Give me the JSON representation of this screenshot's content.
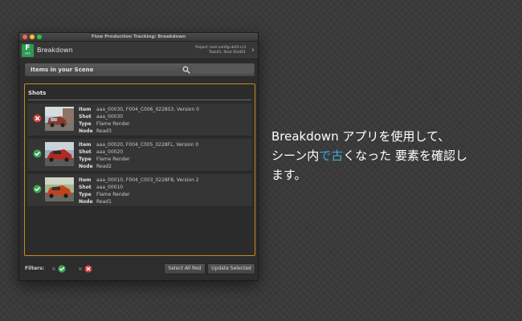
{
  "window": {
    "title": "Flow Production Tracking: Breakdown",
    "app_name": "Breakdown",
    "logo_letter": "F",
    "logo_sub": "FPT",
    "context_line1": "Project: test-config-def3-rc3",
    "context_line2": "Task01, Shot Shot01"
  },
  "items_bar": {
    "label": "Items in your Scene",
    "search_placeholder": ""
  },
  "shots_section": {
    "header": "Shots",
    "field_labels": {
      "item": "Item",
      "shot": "Shot",
      "type": "Type",
      "node": "Node"
    },
    "rows": [
      {
        "status": "out-of-date",
        "item": "aaa_00030, F004_C006_0228S3, Version 0",
        "shot": "aaa_00030",
        "type": "Flame Render",
        "node": "Read3"
      },
      {
        "status": "up-to-date",
        "item": "aaa_00020, F004_C005_0228FL, Version 0",
        "shot": "aaa_00020",
        "type": "Flame Render",
        "node": "Read2"
      },
      {
        "status": "up-to-date",
        "item": "aaa_00010, F004_C003_0228F8, Version 2",
        "shot": "aaa_00010",
        "type": "Flame Render",
        "node": "Read1"
      }
    ]
  },
  "footer": {
    "filters_label": "Filters:",
    "select_all_red": "Select All Red",
    "update_selected": "Update Selected"
  },
  "caption": {
    "line1": "Breakdown アプリを使用して、",
    "line2_a": "シーン内",
    "line2_b": "で古",
    "line2_c": "くなった 要素を確認し",
    "line3": "ます。"
  },
  "colors": {
    "highlight_text": "#3fa8d8",
    "panel_border": "#c98a1c",
    "ok_green": "#3aa655",
    "error_red": "#d23b3b",
    "logo_green": "#2f9a55"
  },
  "icons": {
    "search": "search-icon",
    "status_ok": "check-circle-icon",
    "status_bad": "x-circle-icon",
    "chevron": "chevron-right-icon"
  }
}
